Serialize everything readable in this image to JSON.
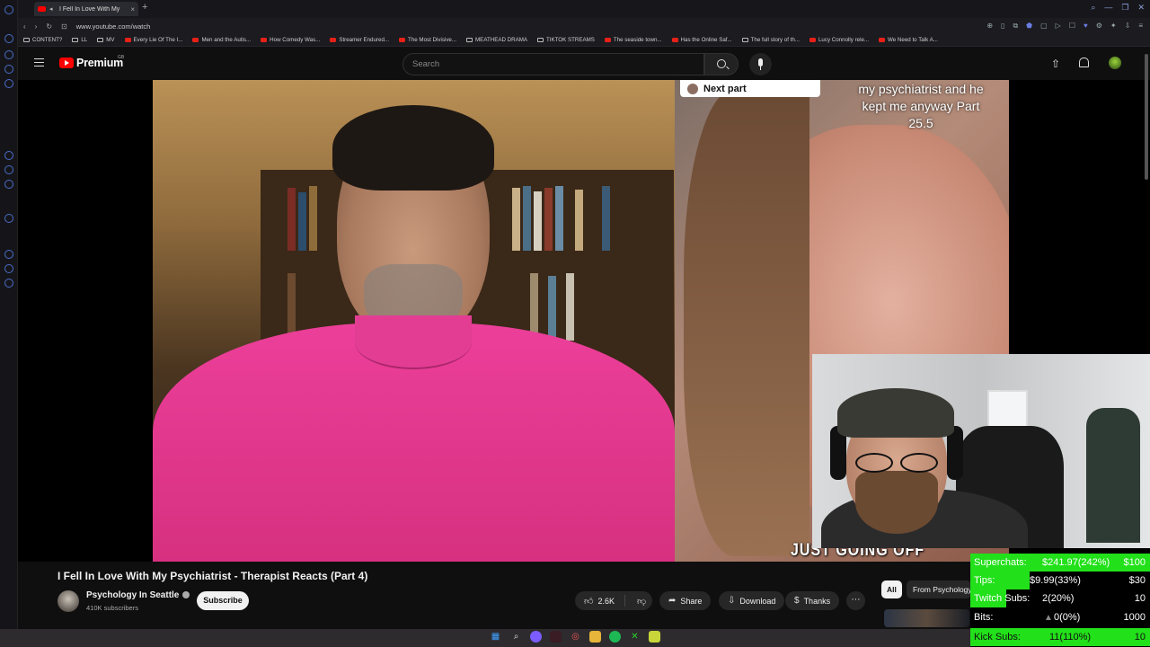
{
  "browser": {
    "tab_title": "I Fell In Love With My",
    "url": "www.youtube.com/watch",
    "new_tab_glyph": "+",
    "tab_close_glyph": "×",
    "window_controls": [
      "⌕",
      "—",
      "❐",
      "✕"
    ]
  },
  "bookmarks": [
    {
      "label": "CONTENT?",
      "icon": "folder"
    },
    {
      "label": "LL",
      "icon": "folder"
    },
    {
      "label": "MV",
      "icon": "folder"
    },
    {
      "label": "Every Lie Of The I...",
      "icon": "youtube"
    },
    {
      "label": "Men and the Autis...",
      "icon": "youtube"
    },
    {
      "label": "How Comedy Was...",
      "icon": "youtube"
    },
    {
      "label": "Streamer Endured...",
      "icon": "youtube"
    },
    {
      "label": "The Most Divisive...",
      "icon": "youtube"
    },
    {
      "label": "MEATHEAD DRAMA",
      "icon": "folder"
    },
    {
      "label": "TIKTOK STREAMS",
      "icon": "folder"
    },
    {
      "label": "The seaside town...",
      "icon": "youtube"
    },
    {
      "label": "Has the Online Saf...",
      "icon": "youtube"
    },
    {
      "label": "The full story of th...",
      "icon": "folder"
    },
    {
      "label": "Lucy Connolly rele...",
      "icon": "youtube"
    },
    {
      "label": "We Need to Talk A...",
      "icon": "youtube"
    }
  ],
  "youtube": {
    "logo_text": "Premium",
    "region": "GB",
    "search_placeholder": "Search"
  },
  "video": {
    "next_part_label": "Next part",
    "overlay_text": "my psychiatrist and he kept me anyway Part 25.5",
    "subtitle": "JUST GOING OFF",
    "title": "I Fell In Love With My Psychiatrist - Therapist Reacts (Part 4)",
    "channel": "Psychology In Seattle",
    "subscribers": "410K subscribers",
    "subscribe_label": "Subscribe",
    "likes": "2.6K",
    "share_label": "Share",
    "download_label": "Download",
    "thanks_label": "Thanks",
    "more_glyph": "⋯"
  },
  "chips": {
    "all": "All",
    "from": "From Psychology"
  },
  "stats": [
    {
      "label": "Superchats:",
      "value": "$241.97(242%)",
      "goal": "$100",
      "fill_percent": 100
    },
    {
      "label": "Tips:",
      "value": "$9.99(33%)",
      "goal": "$30",
      "fill_percent": 33
    },
    {
      "label": "Twitch Subs:",
      "value": "2(20%)",
      "goal": "10",
      "fill_percent": 20
    },
    {
      "label": "Bits:",
      "value": "0(0%)",
      "goal": "1000",
      "fill_percent": 0
    },
    {
      "label": "Kick Subs:",
      "value": "11(110%)",
      "goal": "10",
      "fill_percent": 100
    }
  ],
  "colors": {
    "youtube_red": "#ff0000",
    "stats_green": "#22e01a",
    "shirt_pink": "#e23d93"
  }
}
